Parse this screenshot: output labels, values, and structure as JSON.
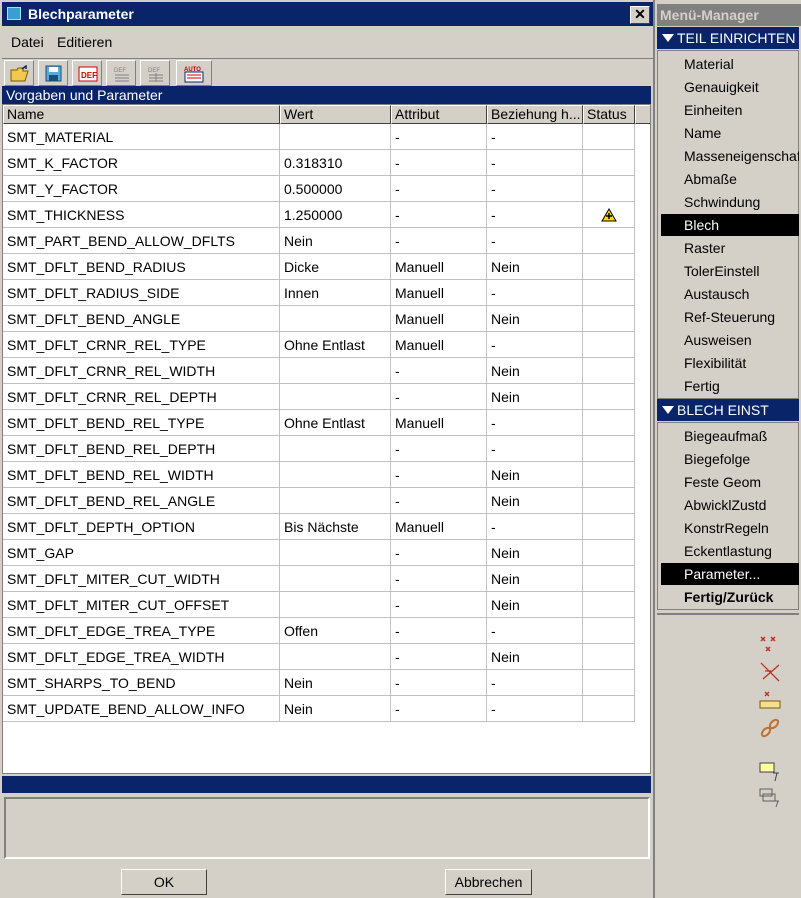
{
  "dialog": {
    "title": "Blechparameter",
    "close_label": "✕",
    "menu": [
      "Datei",
      "Editieren"
    ],
    "toolbar_icons": [
      "open-folder-icon",
      "save-icon",
      "def-icon",
      "def-list-icon",
      "def-list-icon-2",
      "auto-icon"
    ],
    "section_title": "Vorgaben und Parameter",
    "columns": [
      "Name",
      "Wert",
      "Attribut",
      "Beziehung h...",
      "Status"
    ],
    "rows": [
      {
        "name": "SMT_MATERIAL",
        "value": "",
        "attr": "-",
        "rel": "-",
        "status": ""
      },
      {
        "name": "SMT_K_FACTOR",
        "value": "0.318310",
        "attr": "-",
        "rel": "-",
        "status": ""
      },
      {
        "name": "SMT_Y_FACTOR",
        "value": "0.500000",
        "attr": "-",
        "rel": "-",
        "status": ""
      },
      {
        "name": "SMT_THICKNESS",
        "value": "1.250000",
        "attr": "-",
        "rel": "-",
        "status": "warning-icon"
      },
      {
        "name": "SMT_PART_BEND_ALLOW_DFLTS",
        "value": "Nein",
        "attr": "-",
        "rel": "-",
        "status": ""
      },
      {
        "name": "SMT_DFLT_BEND_RADIUS",
        "value": "Dicke",
        "attr": "Manuell",
        "rel": "Nein",
        "status": ""
      },
      {
        "name": "SMT_DFLT_RADIUS_SIDE",
        "value": "Innen",
        "attr": "Manuell",
        "rel": "-",
        "status": ""
      },
      {
        "name": "SMT_DFLT_BEND_ANGLE",
        "value": "",
        "attr": "Manuell",
        "rel": "Nein",
        "status": ""
      },
      {
        "name": "SMT_DFLT_CRNR_REL_TYPE",
        "value": "Ohne Entlast",
        "attr": "Manuell",
        "rel": "-",
        "status": ""
      },
      {
        "name": "SMT_DFLT_CRNR_REL_WIDTH",
        "value": "",
        "attr": "-",
        "rel": "Nein",
        "status": ""
      },
      {
        "name": "SMT_DFLT_CRNR_REL_DEPTH",
        "value": "",
        "attr": "-",
        "rel": "Nein",
        "status": ""
      },
      {
        "name": "SMT_DFLT_BEND_REL_TYPE",
        "value": "Ohne Entlast",
        "attr": "Manuell",
        "rel": "-",
        "status": ""
      },
      {
        "name": "SMT_DFLT_BEND_REL_DEPTH",
        "value": "",
        "attr": "-",
        "rel": "-",
        "status": ""
      },
      {
        "name": "SMT_DFLT_BEND_REL_WIDTH",
        "value": "",
        "attr": "-",
        "rel": "Nein",
        "status": ""
      },
      {
        "name": "SMT_DFLT_BEND_REL_ANGLE",
        "value": "",
        "attr": "-",
        "rel": "Nein",
        "status": ""
      },
      {
        "name": "SMT_DFLT_DEPTH_OPTION",
        "value": "Bis Nächste",
        "attr": "Manuell",
        "rel": "-",
        "status": ""
      },
      {
        "name": "SMT_GAP",
        "value": "",
        "attr": "-",
        "rel": "Nein",
        "status": ""
      },
      {
        "name": "SMT_DFLT_MITER_CUT_WIDTH",
        "value": "",
        "attr": "-",
        "rel": "Nein",
        "status": ""
      },
      {
        "name": "SMT_DFLT_MITER_CUT_OFFSET",
        "value": "",
        "attr": "-",
        "rel": "Nein",
        "status": ""
      },
      {
        "name": "SMT_DFLT_EDGE_TREA_TYPE",
        "value": "Offen",
        "attr": "-",
        "rel": "-",
        "status": ""
      },
      {
        "name": "SMT_DFLT_EDGE_TREA_WIDTH",
        "value": "",
        "attr": "-",
        "rel": "Nein",
        "status": ""
      },
      {
        "name": "SMT_SHARPS_TO_BEND",
        "value": "Nein",
        "attr": "-",
        "rel": "-",
        "status": ""
      },
      {
        "name": "SMT_UPDATE_BEND_ALLOW_INFO",
        "value": "Nein",
        "attr": "-",
        "rel": "-",
        "status": ""
      }
    ],
    "ok_label": "OK",
    "cancel_label": "Abbrechen"
  },
  "menu_manager": {
    "title": "Menü-Manager",
    "group1_title": "TEIL EINRICHTEN",
    "group1_items": [
      "Material",
      "Genauigkeit",
      "Einheiten",
      "Name",
      "Masseneigenschaften",
      "Abmaße",
      "Schwindung",
      "Blech",
      "Raster",
      "TolerEinstell",
      "Austausch",
      "Ref-Steuerung",
      "Ausweisen",
      "Flexibilität",
      "Fertig"
    ],
    "group1_selected": "Blech",
    "group2_title": "BLECH EINST",
    "group2_items": [
      "Biegeaufmaß",
      "Biegefolge",
      "Feste Geom",
      "AbwicklZustd",
      "KonstrRegeln",
      "Eckentlastung",
      "Parameter...",
      "Fertig/Zurück"
    ],
    "group2_selected": "Parameter...",
    "group2_bold": "Fertig/Zurück"
  },
  "colors": {
    "title_blue": "#0a246a",
    "face": "#d4d0c8",
    "warning_yellow": "#ffd800"
  }
}
